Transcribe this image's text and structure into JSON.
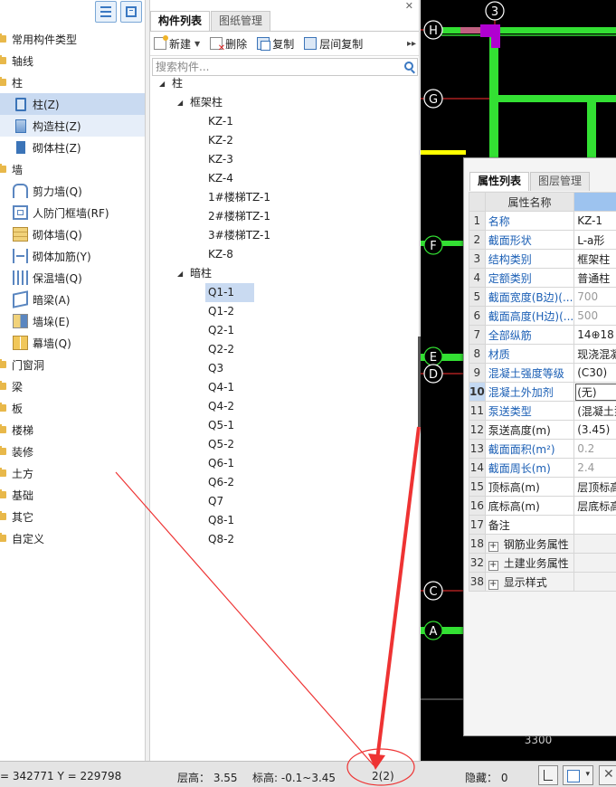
{
  "nav": {
    "items": [
      {
        "label": "常用构件类型",
        "level": 0,
        "icon": "folder-icon"
      },
      {
        "label": "轴线",
        "level": 0,
        "icon": "folder-icon"
      },
      {
        "label": "柱",
        "level": 0,
        "icon": "folder-icon"
      },
      {
        "label": "柱(Z)",
        "level": 1,
        "icon": "column-icon",
        "selected": true
      },
      {
        "label": "构造柱(Z)",
        "level": 1,
        "icon": "constructional-column-icon",
        "hover": true
      },
      {
        "label": "砌体柱(Z)",
        "level": 1,
        "icon": "masonry-column-icon"
      },
      {
        "label": "墙",
        "level": 0,
        "icon": "folder-icon"
      },
      {
        "label": "剪力墙(Q)",
        "level": 1,
        "icon": "shear-wall-icon"
      },
      {
        "label": "人防门框墙(RF)",
        "level": 1,
        "icon": "civil-defense-door-wall-icon"
      },
      {
        "label": "砌体墙(Q)",
        "level": 1,
        "icon": "masonry-wall-icon"
      },
      {
        "label": "砌体加筋(Y)",
        "level": 1,
        "icon": "masonry-reinforcement-icon"
      },
      {
        "label": "保温墙(Q)",
        "level": 1,
        "icon": "insulation-wall-icon"
      },
      {
        "label": "暗梁(A)",
        "level": 1,
        "icon": "hidden-beam-icon"
      },
      {
        "label": "墙垛(E)",
        "level": 1,
        "icon": "wall-pier-icon"
      },
      {
        "label": "幕墙(Q)",
        "level": 1,
        "icon": "curtain-wall-icon"
      },
      {
        "label": "门窗洞",
        "level": 0,
        "icon": "folder-icon"
      },
      {
        "label": "梁",
        "level": 0,
        "icon": "folder-icon"
      },
      {
        "label": "板",
        "level": 0,
        "icon": "folder-icon"
      },
      {
        "label": "楼梯",
        "level": 0,
        "icon": "folder-icon"
      },
      {
        "label": "装修",
        "level": 0,
        "icon": "folder-icon"
      },
      {
        "label": "土方",
        "level": 0,
        "icon": "folder-icon"
      },
      {
        "label": "基础",
        "level": 0,
        "icon": "folder-icon"
      },
      {
        "label": "其它",
        "level": 0,
        "icon": "folder-icon"
      },
      {
        "label": "自定义",
        "level": 0,
        "icon": "folder-icon"
      }
    ]
  },
  "component_panel": {
    "tabs": [
      {
        "label": "构件列表",
        "active": true
      },
      {
        "label": "图纸管理",
        "active": false
      }
    ],
    "toolbar": {
      "new_label": "新建",
      "delete_label": "删除",
      "copy_label": "复制",
      "floor_copy_label": "层间复制"
    },
    "search": {
      "placeholder": "搜索构件..."
    },
    "tree": [
      {
        "label": "柱",
        "level": 0,
        "toggle": "◢"
      },
      {
        "label": "框架柱",
        "level": 1,
        "toggle": "◢"
      },
      {
        "label": "KZ-1",
        "level": 2
      },
      {
        "label": "KZ-2",
        "level": 2
      },
      {
        "label": "KZ-3",
        "level": 2
      },
      {
        "label": "KZ-4",
        "level": 2
      },
      {
        "label": "1#楼梯TZ-1",
        "level": 2
      },
      {
        "label": "2#楼梯TZ-1",
        "level": 2
      },
      {
        "label": "3#楼梯TZ-1",
        "level": 2
      },
      {
        "label": "KZ-8",
        "level": 2
      },
      {
        "label": "暗柱",
        "level": 1,
        "toggle": "◢"
      },
      {
        "label": "Q1-1",
        "level": 2,
        "selected": true
      },
      {
        "label": "Q1-2",
        "level": 2
      },
      {
        "label": "Q2-1",
        "level": 2
      },
      {
        "label": "Q2-2",
        "level": 2
      },
      {
        "label": "Q3",
        "level": 2
      },
      {
        "label": "Q4-1",
        "level": 2
      },
      {
        "label": "Q4-2",
        "level": 2
      },
      {
        "label": "Q5-1",
        "level": 2
      },
      {
        "label": "Q5-2",
        "level": 2
      },
      {
        "label": "Q6-1",
        "level": 2
      },
      {
        "label": "Q6-2",
        "level": 2
      },
      {
        "label": "Q7",
        "level": 2
      },
      {
        "label": "Q8-1",
        "level": 2
      },
      {
        "label": "Q8-2",
        "level": 2
      }
    ]
  },
  "properties": {
    "tabs": [
      {
        "label": "属性列表",
        "active": true
      },
      {
        "label": "图层管理",
        "active": false
      }
    ],
    "header": {
      "name": "属性名称",
      "value": ""
    },
    "rows": [
      {
        "num": "1",
        "key": "名称",
        "value": "KZ-1",
        "blue": true
      },
      {
        "num": "2",
        "key": "截面形状",
        "value": "L-a形",
        "blue": true
      },
      {
        "num": "3",
        "key": "结构类别",
        "value": "框架柱",
        "blue": true
      },
      {
        "num": "4",
        "key": "定额类别",
        "value": "普通柱",
        "blue": true
      },
      {
        "num": "5",
        "key": "截面宽度(B边)(...",
        "value": "700",
        "blue": true,
        "dim": true
      },
      {
        "num": "6",
        "key": "截面高度(H边)(...",
        "value": "500",
        "blue": true,
        "dim": true
      },
      {
        "num": "7",
        "key": "全部纵筋",
        "value": "14⊕18",
        "blue": true
      },
      {
        "num": "8",
        "key": "材质",
        "value": "现浇混凝土",
        "blue": true
      },
      {
        "num": "9",
        "key": "混凝土强度等级",
        "value": "(C30)",
        "blue": true
      },
      {
        "num": "10",
        "key": "混凝土外加剂",
        "value": "(无)",
        "blue": true,
        "current": true
      },
      {
        "num": "11",
        "key": "泵送类型",
        "value": "(混凝土泵)",
        "blue": true
      },
      {
        "num": "12",
        "key": "泵送高度(m)",
        "value": "(3.45)",
        "blue": false
      },
      {
        "num": "13",
        "key": "截面面积(m²)",
        "value": "0.2",
        "blue": true,
        "dim": true
      },
      {
        "num": "14",
        "key": "截面周长(m)",
        "value": "2.4",
        "blue": true,
        "dim": true
      },
      {
        "num": "15",
        "key": "顶标高(m)",
        "value": "层顶标高",
        "blue": false
      },
      {
        "num": "16",
        "key": "底标高(m)",
        "value": "层底标高",
        "blue": false
      },
      {
        "num": "17",
        "key": "备注",
        "value": "",
        "blue": false
      },
      {
        "num": "18",
        "key": "钢筋业务属性",
        "value": "",
        "group": true
      },
      {
        "num": "32",
        "key": "土建业务属性",
        "value": "",
        "group": true
      },
      {
        "num": "38",
        "key": "显示样式",
        "value": "",
        "group": true
      }
    ]
  },
  "canvas": {
    "axis_labels": [
      "3",
      "H",
      "G",
      "F",
      "E",
      "D",
      "C",
      "A"
    ],
    "bottom_text": "3300",
    "colors": {
      "wall": "#33e033",
      "column": "#b000d0",
      "axis": "#ff3030",
      "label_circle": "#ffffff",
      "highlight": "#ffff00"
    }
  },
  "status_bar": {
    "coords": "= 342771 Y = 229798",
    "floor_height": "层高： 3.55",
    "elevation": "标高: -0.1~3.45",
    "selection_count": "2(2)",
    "hidden": "隐藏： 0"
  },
  "annotation": {
    "color": "#ee3333"
  }
}
